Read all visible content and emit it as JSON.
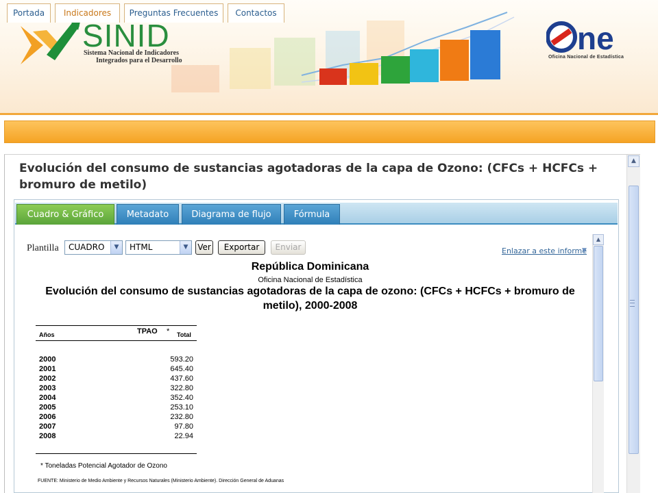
{
  "header": {
    "sinid_wordmark": "SINID",
    "sinid_tagline_line1": "Sistema Nacional de Indicadores",
    "sinid_tagline_line2": "Integrados para el Desarrollo",
    "one_wordmark": "ne",
    "one_subtitle": "Oficina Nacional de Estadística"
  },
  "nav": {
    "tabs": [
      {
        "label": "Portada",
        "active": false
      },
      {
        "label": "Indicadores",
        "active": true
      },
      {
        "label": "Preguntas Frecuentes",
        "active": false
      },
      {
        "label": "Contactos",
        "active": false
      }
    ]
  },
  "page": {
    "title": "Evolución del consumo de sustancias agotadoras de la capa de Ozono: (CFCs + HCFCs + bromuro de metilo)"
  },
  "panel": {
    "tabs": [
      {
        "label": "Cuadro & Gráfico",
        "active": true
      },
      {
        "label": "Metadato",
        "active": false
      },
      {
        "label": "Diagrama de flujo",
        "active": false
      },
      {
        "label": "Fórmula",
        "active": false
      }
    ]
  },
  "toolbar": {
    "template_label": "Plantilla",
    "template_value": "CUADRO",
    "format_value": "HTML",
    "view_button": "Ver",
    "export_button": "Exportar",
    "send_button": "Enviar",
    "link_label": "Enlazar a este informe"
  },
  "report": {
    "country": "República Dominicana",
    "office": "Oficina Nacional de Estadística",
    "title": "Evolución del consumo de sustancias agotadoras de la capa de ozono: (CFCs + HCFCs + bromuro de metilo), 2000-2008",
    "group_header": "TPAO",
    "group_header_mark": "*",
    "col_year": "Años",
    "col_total": "Total",
    "rows": [
      {
        "year": "2000",
        "value": "593.20"
      },
      {
        "year": "2001",
        "value": "645.40"
      },
      {
        "year": "2002",
        "value": "437.60"
      },
      {
        "year": "2003",
        "value": "322.80"
      },
      {
        "year": "2004",
        "value": "352.40"
      },
      {
        "year": "2005",
        "value": "253.10"
      },
      {
        "year": "2006",
        "value": "232.80"
      },
      {
        "year": "2007",
        "value": "97.80"
      },
      {
        "year": "2008",
        "value": "22.94"
      }
    ],
    "footnote": "* Toneladas Potencial Agotador de Ozono",
    "source": "FUENTE: Ministerio de Medio Ambiente y Recursos Naturales (Ministerio Ambiente).   Dirección General de Aduanas"
  },
  "colors": {
    "nav_orange": "#f5a324",
    "tab_blue": "#2f7fb8",
    "tab_green": "#5aa43a",
    "link_blue": "#336699"
  }
}
